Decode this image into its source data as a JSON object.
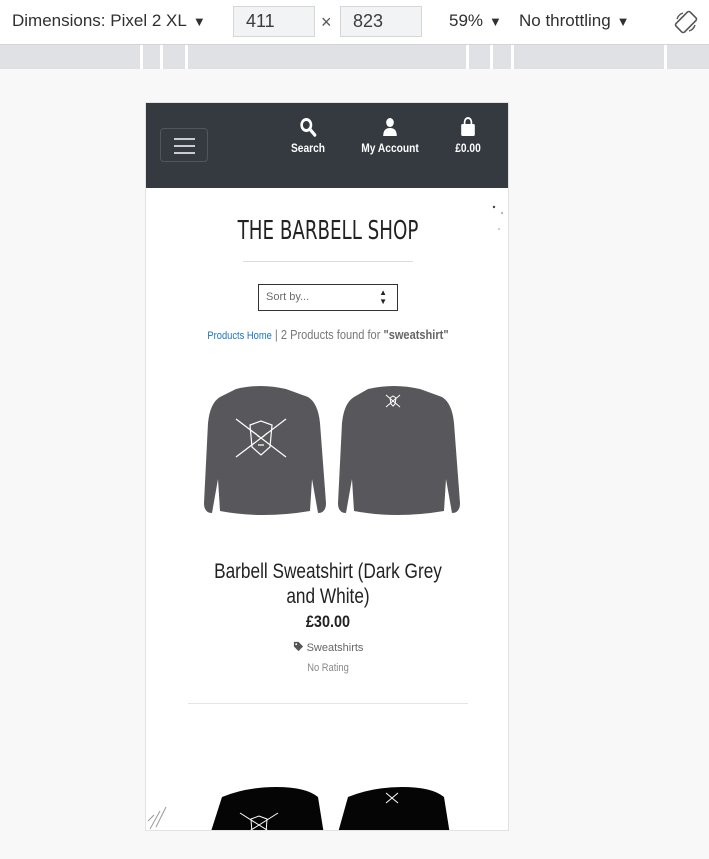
{
  "devtools": {
    "dimensions_label": "Dimensions: Pixel 2 XL",
    "width": "411",
    "height": "823",
    "times": "×",
    "zoom": "59%",
    "throttling": "No throttling",
    "caret": "▼"
  },
  "site": {
    "nav": {
      "search_label": "Search",
      "account_label": "My Account",
      "cart_label": "£0.00"
    },
    "title": "THE BARBELL SHOP",
    "sort": {
      "selected": "Sort by..."
    },
    "results": {
      "home_link": "Products Home",
      "separator": " | ",
      "found_text": "2 Products found for ",
      "query": "\"sweatshirt\""
    },
    "products": [
      {
        "name": "Barbell Sweatshirt (Dark Grey and White)",
        "price": "£30.00",
        "category": "Sweatshirts",
        "rating": "No Rating",
        "color": "#58585c"
      },
      {
        "color": "#050505"
      }
    ],
    "colors": {
      "header_bg": "#343a40",
      "link": "#1a73c5"
    }
  }
}
